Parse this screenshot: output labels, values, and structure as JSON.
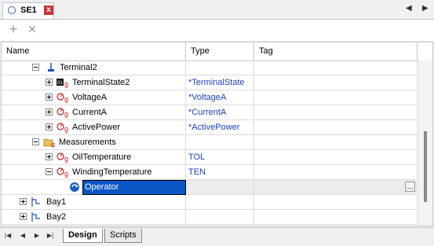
{
  "tab": {
    "title": "SE1",
    "close_label": "x",
    "nav_left": "◀",
    "nav_right": "▶"
  },
  "toolbar": {
    "add_label": "+",
    "remove_label": "✕"
  },
  "columns": {
    "name": "Name",
    "type": "Type",
    "tag": "Tag"
  },
  "rows": [
    {
      "name": "Terminal2",
      "type": "",
      "tag": ""
    },
    {
      "name": "TerminalState2",
      "type": "*TerminalState",
      "tag": ""
    },
    {
      "name": "VoltageA",
      "type": "*VoltageA",
      "tag": ""
    },
    {
      "name": "CurrentA",
      "type": "*CurrentA",
      "tag": ""
    },
    {
      "name": "ActivePower",
      "type": "*ActivePower",
      "tag": ""
    },
    {
      "name": "Measurements",
      "type": "",
      "tag": ""
    },
    {
      "name": "OilTemperature",
      "type": "TOL",
      "tag": ""
    },
    {
      "name": "WindingTemperature",
      "type": "TEN",
      "tag": ""
    },
    {
      "name": "Operator",
      "type": "",
      "tag": "..."
    },
    {
      "name": "Bay1",
      "type": "",
      "tag": ""
    },
    {
      "name": "Bay2",
      "type": "",
      "tag": ""
    }
  ],
  "bottom": {
    "tabs": [
      "Design",
      "Scripts"
    ],
    "nav": [
      "|◀",
      "◀",
      "▶",
      "▶|"
    ]
  },
  "colors": {
    "selection": "#0a56c6",
    "type_text": "#1f3fbf",
    "tab_close": "#cc3333"
  }
}
